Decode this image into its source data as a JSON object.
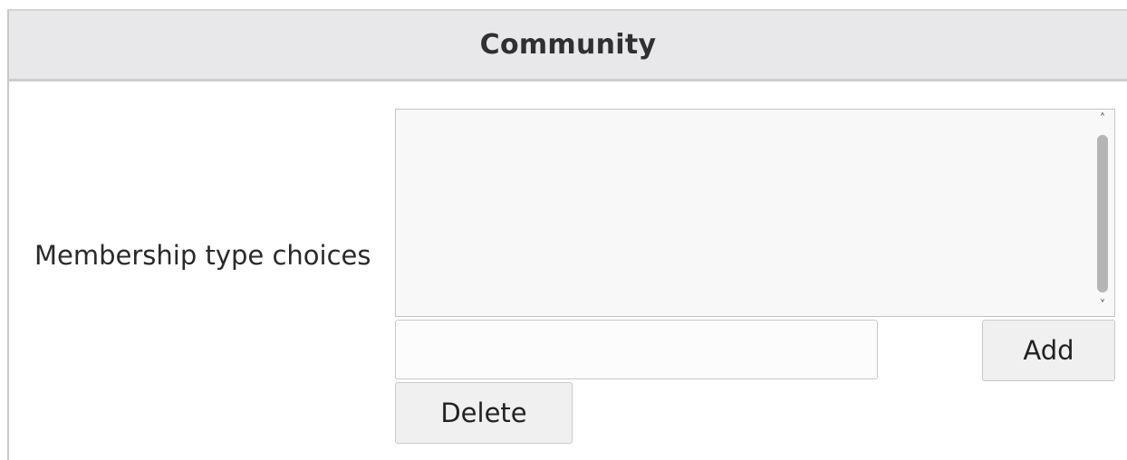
{
  "panel": {
    "title": "Community"
  },
  "field": {
    "label": "Membership type choices",
    "listbox_items": [],
    "input_value": "",
    "add_label": "Add",
    "delete_label": "Delete"
  },
  "icons": {
    "scroll_up": "chevron-up-icon",
    "scroll_down": "chevron-down-icon"
  },
  "colors": {
    "header_bg": "#e8e8ea",
    "button_bg": "#f0f0f0",
    "list_bg": "#f8f8f8"
  }
}
